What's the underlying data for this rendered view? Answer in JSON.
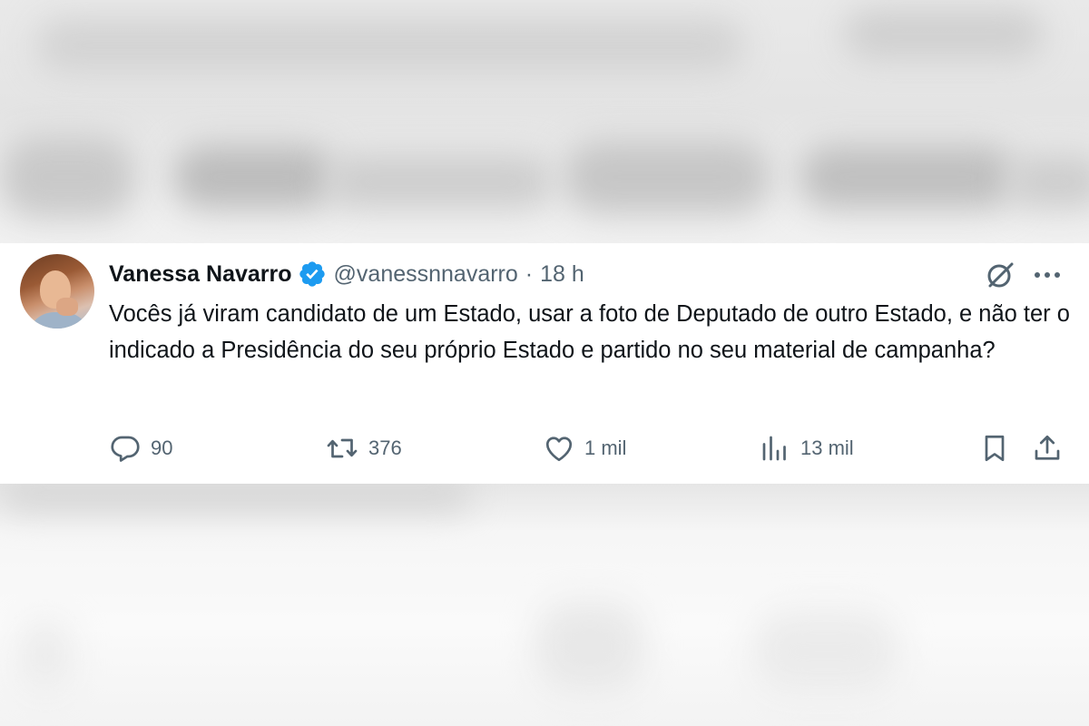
{
  "tweet": {
    "author_name": "Vanessa Navarro",
    "handle": "@vanessnnavarro",
    "separator": "·",
    "time": "18 h",
    "text": "Vocês já viram candidato de um Estado, usar a foto de Deputado de outro Estado, e não ter o indicado a Presidência do seu próprio Estado e partido no seu material de campanha?",
    "verified": true
  },
  "actions": {
    "replies": "90",
    "reposts": "376",
    "likes": "1 mil",
    "views": "13 mil"
  },
  "icons": {
    "verified": "verified-badge-icon",
    "grok": "grok-icon",
    "more": "more-dots-icon",
    "reply": "reply-icon",
    "repost": "repost-icon",
    "like": "heart-icon",
    "views": "views-chart-icon",
    "bookmark": "bookmark-icon",
    "share": "share-icon"
  },
  "colors": {
    "text_primary": "#0f1419",
    "text_secondary": "#536471",
    "verified_blue": "#1d9bf0"
  }
}
